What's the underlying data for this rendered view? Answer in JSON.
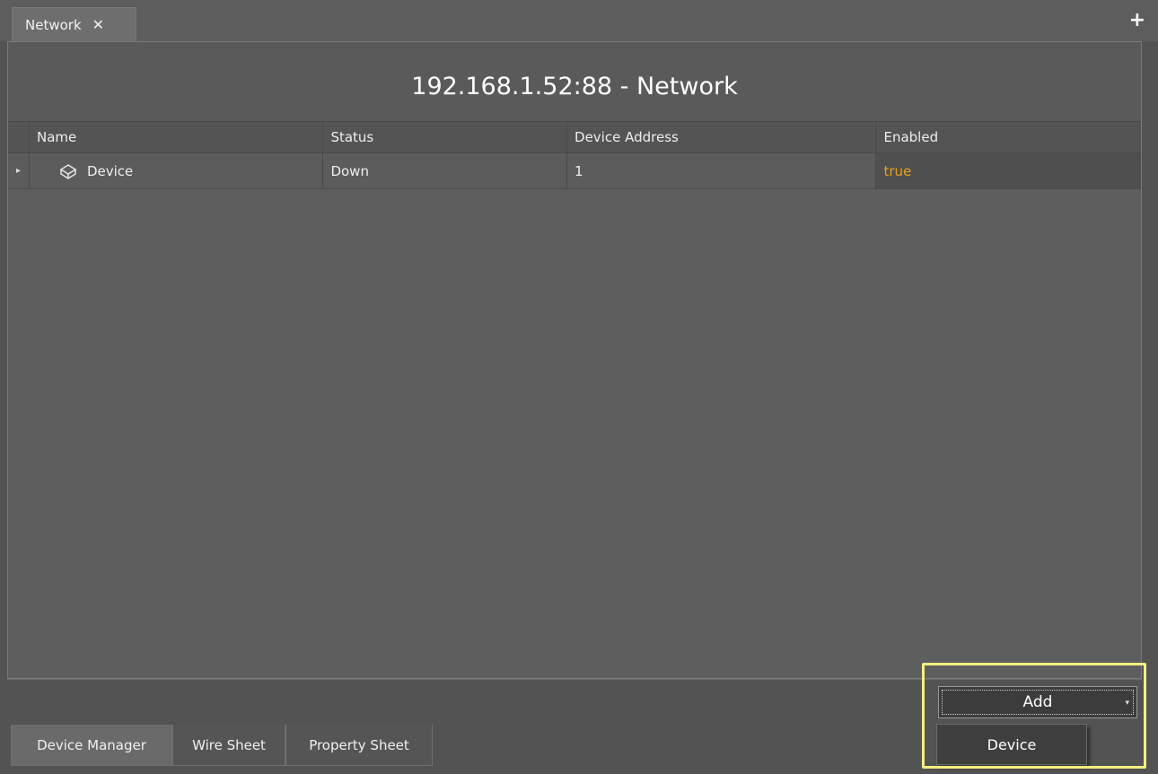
{
  "tab": {
    "label": "Network",
    "close": "✕"
  },
  "add_tab": "+",
  "title": "192.168.1.52:88 - Network",
  "table": {
    "headers": [
      "Name",
      "Status",
      "Device Address",
      "Enabled"
    ],
    "rows": [
      {
        "expander": "▸",
        "name": "Device",
        "status": "Down",
        "address": "1",
        "enabled": "true"
      }
    ]
  },
  "colors": {
    "enabled_true": "#e8a21f",
    "highlight": "#f5ee82"
  },
  "icons": {
    "expander": "triangle-right",
    "device": "device-box-icon",
    "add_dropdown": "triangle-down"
  },
  "add_button": {
    "label": "Add",
    "arrow": "▾"
  },
  "add_menu": {
    "items": [
      "Device"
    ]
  },
  "bottom_tabs": [
    {
      "label": "Device Manager",
      "active": true
    },
    {
      "label": "Wire Sheet",
      "active": false
    },
    {
      "label": "Property Sheet",
      "active": false
    }
  ]
}
